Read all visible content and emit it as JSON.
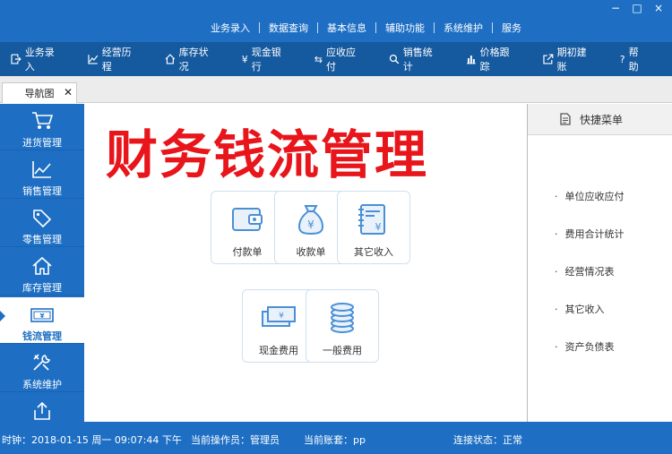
{
  "window": {
    "controls": [
      "−",
      "□",
      "×"
    ]
  },
  "top_menu": [
    "业务录入",
    "数据查询",
    "基本信息",
    "辅助功能",
    "系统维护",
    "服务"
  ],
  "toolbar": [
    {
      "label": "业务录入",
      "icon": "import-icon"
    },
    {
      "label": "经营历程",
      "icon": "trend-icon"
    },
    {
      "label": "库存状况",
      "icon": "home-icon"
    },
    {
      "label": "现金银行",
      "icon": "yen-icon"
    },
    {
      "label": "应收应付",
      "icon": "exchange-icon"
    },
    {
      "label": "销售统计",
      "icon": "search-icon"
    },
    {
      "label": "价格跟踪",
      "icon": "bar-chart-icon"
    },
    {
      "label": "期初建账",
      "icon": "external-icon"
    },
    {
      "label": "帮助",
      "icon": "help-icon"
    }
  ],
  "tab": {
    "label": "导航图",
    "close": "✕"
  },
  "sidebar": [
    {
      "label": "进货管理",
      "icon": "cart-icon"
    },
    {
      "label": "销售管理",
      "icon": "chart-line-icon"
    },
    {
      "label": "零售管理",
      "icon": "tag-icon"
    },
    {
      "label": "库存管理",
      "icon": "home-icon"
    },
    {
      "label": "钱流管理",
      "icon": "money-icon"
    },
    {
      "label": "系统维护",
      "icon": "tools-icon"
    },
    {
      "label": "",
      "icon": "share-icon"
    }
  ],
  "main": {
    "title": "财务钱流管理",
    "tiles": [
      {
        "label": "付款单",
        "icon": "wallet-icon"
      },
      {
        "label": "收款单",
        "icon": "money-bag-icon"
      },
      {
        "label": "其它收入",
        "icon": "ledger-yen-icon"
      },
      {
        "label": "现金费用",
        "icon": "cash-icon"
      },
      {
        "label": "一般费用",
        "icon": "coins-icon"
      }
    ]
  },
  "quick_menu": {
    "title": "快捷菜单",
    "items": [
      "单位应收应付",
      "费用合计统计",
      "经营情况表",
      "其它收入",
      "资产负债表"
    ]
  },
  "status": {
    "clock": "时钟：2018-01-15 周一 09:07:44 下午",
    "operator": "当前操作员：管理员",
    "account": "当前账套：pp",
    "connection": "连接状态：正常"
  }
}
